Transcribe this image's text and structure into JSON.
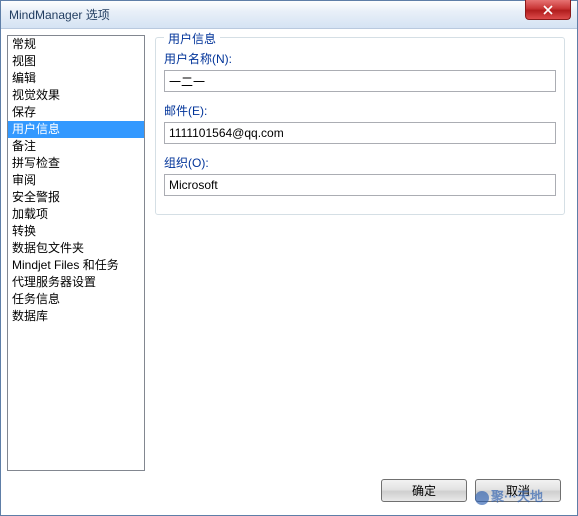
{
  "window": {
    "title": "MindManager 选项"
  },
  "sidebar": {
    "items": [
      {
        "label": "常规"
      },
      {
        "label": "视图"
      },
      {
        "label": "编辑"
      },
      {
        "label": "视觉效果"
      },
      {
        "label": "保存"
      },
      {
        "label": "用户信息",
        "selected": true
      },
      {
        "label": "备注"
      },
      {
        "label": "拼写检查"
      },
      {
        "label": "审阅"
      },
      {
        "label": "安全警报"
      },
      {
        "label": "加载项"
      },
      {
        "label": "转换"
      },
      {
        "label": "数据包文件夹"
      },
      {
        "label": "Mindjet Files 和任务"
      },
      {
        "label": "代理服务器设置"
      },
      {
        "label": "任务信息"
      },
      {
        "label": "数据库"
      }
    ]
  },
  "main": {
    "group_title": "用户信息",
    "username_label": "用户名称(N):",
    "username_value": "一二一",
    "email_label": "邮件(E):",
    "email_value": "1111101564@qq.com",
    "org_label": "组织(O):",
    "org_value": "Microsoft"
  },
  "footer": {
    "ok_label": "确定",
    "cancel_label": "取消"
  },
  "watermark": {
    "text": "聚···天地"
  }
}
